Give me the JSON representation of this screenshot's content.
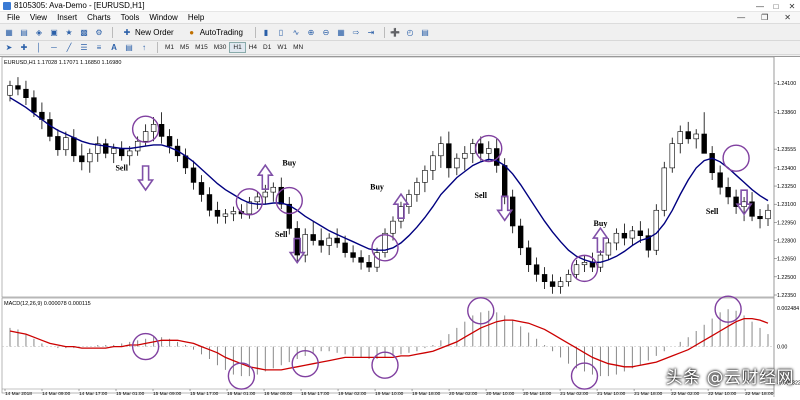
{
  "window": {
    "title": "8105305: Ava-Demo - [EURUSD,H1]"
  },
  "menu": {
    "items": [
      "File",
      "View",
      "Insert",
      "Charts",
      "Tools",
      "Window",
      "Help"
    ]
  },
  "toolbar": {
    "new_order_label": "New Order",
    "autotrading_label": "AutoTrading"
  },
  "timeframes": [
    {
      "label": "M1",
      "active": false
    },
    {
      "label": "M5",
      "active": false
    },
    {
      "label": "M15",
      "active": false
    },
    {
      "label": "M30",
      "active": false
    },
    {
      "label": "H1",
      "active": true
    },
    {
      "label": "H4",
      "active": false
    },
    {
      "label": "D1",
      "active": false
    },
    {
      "label": "W1",
      "active": false
    },
    {
      "label": "MN",
      "active": false
    }
  ],
  "colors": {
    "bull": "#ffffff",
    "bear": "#000000",
    "ma_line": "#000080",
    "signal_line": "#cc0000",
    "circle": "#8040a0",
    "arrow": "#8050a8"
  },
  "chart_data": [
    {
      "type": "candlestick",
      "header": "EURUSD,H1  1.17028 1.17071 1.16850 1.16980",
      "y_ticks": [
        "1.24100",
        "1.23860",
        "1.23555",
        "1.23400",
        "1.23250",
        "1.23100",
        "1.22950",
        "1.22800",
        "1.22650",
        "1.22500",
        "1.22350"
      ],
      "ylim": [
        1.2235,
        1.2425
      ],
      "x_ticks": [
        "14 Mar 2018",
        "14 Mar 09:00",
        "14 Mar 17:00",
        "15 Mar 01:00",
        "15 Mar 09:00",
        "15 Mar 17:00",
        "16 Mar 01:00",
        "16 Mar 09:00",
        "16 Mar 17:00",
        "19 Mar 02:00",
        "19 Mar 10:00",
        "19 Mar 18:00",
        "20 Mar 02:00",
        "20 Mar 10:00",
        "20 Mar 18:00",
        "21 Mar 02:00",
        "21 Mar 10:00",
        "21 Mar 18:00",
        "22 Mar 02:00",
        "22 Mar 10:00",
        "22 Mar 18:00"
      ],
      "candles": [
        [
          1.24,
          1.2412,
          1.2395,
          1.2408
        ],
        [
          1.2408,
          1.2415,
          1.24,
          1.2405
        ],
        [
          1.2405,
          1.2412,
          1.2392,
          1.2398
        ],
        [
          1.2398,
          1.2404,
          1.2382,
          1.2386
        ],
        [
          1.2386,
          1.2394,
          1.2372,
          1.238
        ],
        [
          1.238,
          1.2386,
          1.2362,
          1.2366
        ],
        [
          1.2366,
          1.2372,
          1.235,
          1.2355
        ],
        [
          1.2355,
          1.237,
          1.235,
          1.2365
        ],
        [
          1.2365,
          1.2372,
          1.2345,
          1.235
        ],
        [
          1.235,
          1.236,
          1.2338,
          1.2345
        ],
        [
          1.2345,
          1.2356,
          1.2336,
          1.2352
        ],
        [
          1.2352,
          1.2366,
          1.2345,
          1.236
        ],
        [
          1.236,
          1.2364,
          1.2348,
          1.2352
        ],
        [
          1.2352,
          1.236,
          1.2344,
          1.2356
        ],
        [
          1.2356,
          1.2362,
          1.2346,
          1.235
        ],
        [
          1.235,
          1.2358,
          1.2342,
          1.2354
        ],
        [
          1.2354,
          1.2366,
          1.235,
          1.2362
        ],
        [
          1.2362,
          1.2376,
          1.2358,
          1.237
        ],
        [
          1.237,
          1.2382,
          1.2362,
          1.2376
        ],
        [
          1.2376,
          1.2386,
          1.236,
          1.2366
        ],
        [
          1.2366,
          1.2372,
          1.2352,
          1.2358
        ],
        [
          1.2358,
          1.2364,
          1.2345,
          1.235
        ],
        [
          1.235,
          1.2356,
          1.2335,
          1.234
        ],
        [
          1.234,
          1.2346,
          1.2322,
          1.2328
        ],
        [
          1.2328,
          1.2334,
          1.2312,
          1.2318
        ],
        [
          1.2318,
          1.2324,
          1.23,
          1.2305
        ],
        [
          1.2305,
          1.2312,
          1.2294,
          1.23
        ],
        [
          1.23,
          1.2306,
          1.2294,
          1.2302
        ],
        [
          1.2302,
          1.2308,
          1.2296,
          1.2304
        ],
        [
          1.2304,
          1.231,
          1.2298,
          1.2302
        ],
        [
          1.2302,
          1.2316,
          1.2298,
          1.2312
        ],
        [
          1.2312,
          1.232,
          1.2306,
          1.2316
        ],
        [
          1.2316,
          1.2326,
          1.231,
          1.232
        ],
        [
          1.232,
          1.2328,
          1.2312,
          1.2324
        ],
        [
          1.2324,
          1.2332,
          1.2306,
          1.231
        ],
        [
          1.231,
          1.2316,
          1.2285,
          1.229
        ],
        [
          1.229,
          1.2296,
          1.2262,
          1.2268
        ],
        [
          1.2268,
          1.229,
          1.2262,
          1.2285
        ],
        [
          1.2285,
          1.2296,
          1.2276,
          1.228
        ],
        [
          1.228,
          1.229,
          1.227,
          1.2276
        ],
        [
          1.2276,
          1.2286,
          1.2268,
          1.2282
        ],
        [
          1.2282,
          1.229,
          1.2274,
          1.2278
        ],
        [
          1.2278,
          1.2284,
          1.2266,
          1.227
        ],
        [
          1.227,
          1.2276,
          1.2262,
          1.2266
        ],
        [
          1.2266,
          1.2272,
          1.2256,
          1.2262
        ],
        [
          1.2262,
          1.2268,
          1.2254,
          1.2258
        ],
        [
          1.2258,
          1.2274,
          1.2254,
          1.227
        ],
        [
          1.227,
          1.229,
          1.2266,
          1.2286
        ],
        [
          1.2286,
          1.23,
          1.228,
          1.2296
        ],
        [
          1.2296,
          1.2312,
          1.229,
          1.2308
        ],
        [
          1.2308,
          1.2322,
          1.2302,
          1.2318
        ],
        [
          1.2318,
          1.2332,
          1.2312,
          1.2328
        ],
        [
          1.2328,
          1.2342,
          1.232,
          1.2338
        ],
        [
          1.2338,
          1.2354,
          1.233,
          1.235
        ],
        [
          1.235,
          1.2366,
          1.234,
          1.236
        ],
        [
          1.236,
          1.237,
          1.2332,
          1.234
        ],
        [
          1.234,
          1.2352,
          1.2334,
          1.2348
        ],
        [
          1.2348,
          1.2358,
          1.2338,
          1.2352
        ],
        [
          1.2352,
          1.2364,
          1.2344,
          1.236
        ],
        [
          1.236,
          1.2366,
          1.2346,
          1.2352
        ],
        [
          1.2352,
          1.2362,
          1.2346,
          1.2356
        ],
        [
          1.2356,
          1.2364,
          1.2336,
          1.2342
        ],
        [
          1.2342,
          1.2348,
          1.231,
          1.2316
        ],
        [
          1.2316,
          1.2322,
          1.2286,
          1.2292
        ],
        [
          1.2292,
          1.2298,
          1.2268,
          1.2274
        ],
        [
          1.2274,
          1.228,
          1.2254,
          1.226
        ],
        [
          1.226,
          1.2266,
          1.2246,
          1.2252
        ],
        [
          1.2252,
          1.2258,
          1.224,
          1.2246
        ],
        [
          1.2246,
          1.2252,
          1.2236,
          1.2242
        ],
        [
          1.2242,
          1.225,
          1.2236,
          1.2246
        ],
        [
          1.2246,
          1.2256,
          1.2242,
          1.2252
        ],
        [
          1.2252,
          1.2264,
          1.2248,
          1.226
        ],
        [
          1.226,
          1.2268,
          1.2254,
          1.2262
        ],
        [
          1.2262,
          1.227,
          1.2254,
          1.2258
        ],
        [
          1.2258,
          1.2272,
          1.2254,
          1.2268
        ],
        [
          1.2268,
          1.2282,
          1.2264,
          1.2278
        ],
        [
          1.2278,
          1.229,
          1.2272,
          1.2286
        ],
        [
          1.2286,
          1.2294,
          1.2276,
          1.2282
        ],
        [
          1.2282,
          1.2292,
          1.2276,
          1.2288
        ],
        [
          1.2288,
          1.2296,
          1.2278,
          1.2284
        ],
        [
          1.2284,
          1.229,
          1.2266,
          1.2272
        ],
        [
          1.2272,
          1.231,
          1.2268,
          1.2305
        ],
        [
          1.2305,
          1.2345,
          1.23,
          1.234
        ],
        [
          1.234,
          1.2365,
          1.2336,
          1.236
        ],
        [
          1.236,
          1.2375,
          1.2352,
          1.237
        ],
        [
          1.237,
          1.2378,
          1.236,
          1.2364
        ],
        [
          1.2364,
          1.2372,
          1.2356,
          1.2368
        ],
        [
          1.2368,
          1.2386,
          1.2362,
          1.2352
        ],
        [
          1.2352,
          1.2358,
          1.233,
          1.2336
        ],
        [
          1.2336,
          1.2342,
          1.2318,
          1.2324
        ],
        [
          1.2324,
          1.2332,
          1.231,
          1.2316
        ],
        [
          1.2316,
          1.2322,
          1.2302,
          1.2308
        ],
        [
          1.2308,
          1.2316,
          1.2296,
          1.2312
        ],
        [
          1.2312,
          1.232,
          1.2296,
          1.23
        ],
        [
          1.23,
          1.2306,
          1.229,
          1.2298
        ],
        [
          1.2298,
          1.231,
          1.2292,
          1.2305
        ]
      ],
      "ma": [
        1.2398,
        1.2394,
        1.239,
        1.2385,
        1.238,
        1.2375,
        1.2371,
        1.2368,
        1.2365,
        1.2362,
        1.236,
        1.2359,
        1.2358,
        1.2357,
        1.2356,
        1.2356,
        1.2357,
        1.2358,
        1.2359,
        1.2359,
        1.2357,
        1.2354,
        1.235,
        1.2345,
        1.2339,
        1.2333,
        1.2327,
        1.2322,
        1.2318,
        1.2314,
        1.2311,
        1.231,
        1.231,
        1.2311,
        1.2311,
        1.2309,
        1.2305,
        1.23,
        1.2296,
        1.2292,
        1.2288,
        1.2285,
        1.2282,
        1.2279,
        1.2276,
        1.2273,
        1.2272,
        1.2272,
        1.2274,
        1.2278,
        1.2284,
        1.2291,
        1.2299,
        1.2308,
        1.2318,
        1.2325,
        1.2332,
        1.2337,
        1.2342,
        1.2345,
        1.2347,
        1.2346,
        1.2342,
        1.2335,
        1.2326,
        1.2316,
        1.2306,
        1.2296,
        1.2287,
        1.2279,
        1.2272,
        1.2267,
        1.2264,
        1.2262,
        1.2262,
        1.2264,
        1.2267,
        1.2271,
        1.2276,
        1.228,
        1.2282,
        1.2286,
        1.2294,
        1.2305,
        1.2318,
        1.233,
        1.234,
        1.2346,
        1.2348,
        1.2345,
        1.234,
        1.2334,
        1.2328,
        1.2322,
        1.2317,
        1.2313
      ]
    },
    {
      "type": "macd",
      "header": "MACD(12,26,9) 0.000078 0.000115",
      "y_ticks": [
        "0.002484",
        "0.00",
        "-0.002322"
      ],
      "ylim": [
        -0.0026,
        0.0028
      ],
      "histogram": [
        0.0012,
        0.0011,
        0.0008,
        0.0005,
        0.0002,
        0.0,
        -0.0001,
        -0.0001,
        -0.0001,
        0.0,
        0.0,
        0.0001,
        0.0001,
        0.0001,
        0.0002,
        0.0003,
        0.0004,
        0.0005,
        0.0007,
        0.0006,
        0.0005,
        0.0003,
        0.0001,
        -0.0002,
        -0.0005,
        -0.0008,
        -0.0012,
        -0.0015,
        -0.0018,
        -0.0019,
        -0.0019,
        -0.0018,
        -0.0016,
        -0.0014,
        -0.0012,
        -0.001,
        -0.0008,
        -0.0006,
        -0.0004,
        -0.0003,
        -0.0003,
        -0.0004,
        -0.0005,
        -0.0006,
        -0.0007,
        -0.0008,
        -0.0008,
        -0.0007,
        -0.0006,
        -0.0005,
        -0.0004,
        -0.0003,
        -0.0001,
        0.0001,
        0.0004,
        0.0008,
        0.0012,
        0.0016,
        0.002,
        0.0022,
        0.0023,
        0.0022,
        0.002,
        0.0017,
        0.0013,
        0.0009,
        0.0005,
        0.0001,
        -0.0003,
        -0.0007,
        -0.0011,
        -0.0014,
        -0.0016,
        -0.0018,
        -0.0019,
        -0.0019,
        -0.0018,
        -0.0016,
        -0.0014,
        -0.0012,
        -0.0009,
        -0.0006,
        -0.0003,
        0.0,
        0.0003,
        0.0006,
        0.001,
        0.0014,
        0.0018,
        0.0022,
        0.0024,
        0.0023,
        0.002,
        0.0016,
        0.0012,
        0.0008
      ],
      "signal": [
        0.001,
        0.0009,
        0.0008,
        0.0006,
        0.0004,
        0.0002,
        0.0001,
        0.0,
        0.0,
        -0.0001,
        -0.0001,
        -0.0001,
        -0.0001,
        0.0,
        0.0,
        0.0001,
        0.0001,
        0.0002,
        0.0003,
        0.0004,
        0.0004,
        0.0004,
        0.0003,
        0.0002,
        0.0,
        -0.0002,
        -0.0004,
        -0.0007,
        -0.0009,
        -0.0011,
        -0.0013,
        -0.0014,
        -0.0015,
        -0.0015,
        -0.0015,
        -0.0014,
        -0.0013,
        -0.0012,
        -0.0011,
        -0.001,
        -0.0009,
        -0.0008,
        -0.0007,
        -0.0007,
        -0.0007,
        -0.0007,
        -0.0007,
        -0.0007,
        -0.0007,
        -0.0006,
        -0.0006,
        -0.0005,
        -0.0004,
        -0.0003,
        -0.0001,
        0.0001,
        0.0003,
        0.0006,
        0.0009,
        0.0012,
        0.0014,
        0.0016,
        0.0017,
        0.0017,
        0.0016,
        0.0015,
        0.0013,
        0.0011,
        0.0008,
        0.0005,
        0.0002,
        -0.0001,
        -0.0004,
        -0.0007,
        -0.0009,
        -0.0011,
        -0.0012,
        -0.0013,
        -0.0013,
        -0.0012,
        -0.0011,
        -0.001,
        -0.0008,
        -0.0006,
        -0.0004,
        -0.0002,
        0.0001,
        0.0004,
        0.0007,
        0.001,
        0.0013,
        0.0016,
        0.0018,
        0.0018,
        0.0017,
        0.0015
      ]
    }
  ],
  "annotations": {
    "labels": [
      {
        "text": "Sell",
        "bar": 14,
        "price": 1.2338
      },
      {
        "text": "Buy",
        "bar": 35,
        "price": 1.2342
      },
      {
        "text": "Sell",
        "bar": 34,
        "price": 1.2283
      },
      {
        "text": "Buy",
        "bar": 46,
        "price": 1.2322
      },
      {
        "text": "Sell",
        "bar": 59,
        "price": 1.2315
      },
      {
        "text": "Buy",
        "bar": 74,
        "price": 1.2292
      },
      {
        "text": "Sell",
        "bar": 88,
        "price": 1.2302
      }
    ],
    "arrows": [
      {
        "dir": "down",
        "bar": 17,
        "price": 1.233
      },
      {
        "dir": "up",
        "bar": 32,
        "price": 1.2334
      },
      {
        "dir": "down",
        "bar": 36,
        "price": 1.227
      },
      {
        "dir": "up",
        "bar": 49,
        "price": 1.231
      },
      {
        "dir": "down",
        "bar": 62,
        "price": 1.2305
      },
      {
        "dir": "up",
        "bar": 74,
        "price": 1.2282
      },
      {
        "dir": "down",
        "bar": 92,
        "price": 1.231
      }
    ],
    "price_circles": [
      {
        "bar": 17,
        "price": 1.2372
      },
      {
        "bar": 30,
        "price": 1.2312
      },
      {
        "bar": 35,
        "price": 1.2313
      },
      {
        "bar": 47,
        "price": 1.2274
      },
      {
        "bar": 60,
        "price": 1.2356
      },
      {
        "bar": 72,
        "price": 1.2257
      },
      {
        "bar": 91,
        "price": 1.2348
      }
    ],
    "macd_circles": [
      {
        "bar": 17,
        "value": 0.0
      },
      {
        "bar": 29,
        "value": -0.0019
      },
      {
        "bar": 37,
        "value": -0.0011
      },
      {
        "bar": 47,
        "value": -0.0012
      },
      {
        "bar": 59,
        "value": 0.0023
      },
      {
        "bar": 72,
        "value": -0.0019
      },
      {
        "bar": 90,
        "value": 0.0024
      }
    ]
  },
  "watermark": "头条 @云财经网"
}
